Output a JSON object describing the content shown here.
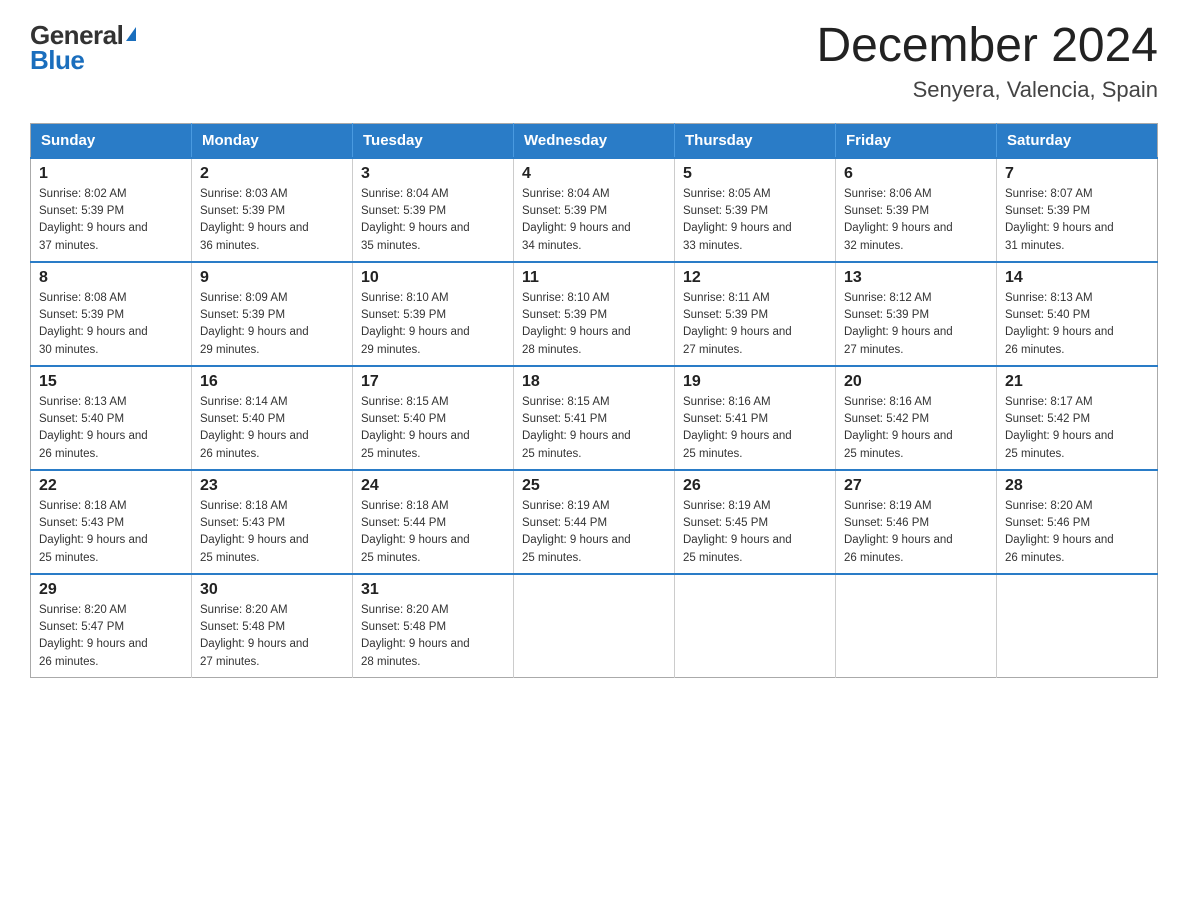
{
  "logo": {
    "general": "General",
    "blue": "Blue",
    "triangle": "▲"
  },
  "header": {
    "month_title": "December 2024",
    "location": "Senyera, Valencia, Spain"
  },
  "days_of_week": [
    "Sunday",
    "Monday",
    "Tuesday",
    "Wednesday",
    "Thursday",
    "Friday",
    "Saturday"
  ],
  "weeks": [
    [
      {
        "day": "1",
        "sunrise": "Sunrise: 8:02 AM",
        "sunset": "Sunset: 5:39 PM",
        "daylight": "Daylight: 9 hours and 37 minutes."
      },
      {
        "day": "2",
        "sunrise": "Sunrise: 8:03 AM",
        "sunset": "Sunset: 5:39 PM",
        "daylight": "Daylight: 9 hours and 36 minutes."
      },
      {
        "day": "3",
        "sunrise": "Sunrise: 8:04 AM",
        "sunset": "Sunset: 5:39 PM",
        "daylight": "Daylight: 9 hours and 35 minutes."
      },
      {
        "day": "4",
        "sunrise": "Sunrise: 8:04 AM",
        "sunset": "Sunset: 5:39 PM",
        "daylight": "Daylight: 9 hours and 34 minutes."
      },
      {
        "day": "5",
        "sunrise": "Sunrise: 8:05 AM",
        "sunset": "Sunset: 5:39 PM",
        "daylight": "Daylight: 9 hours and 33 minutes."
      },
      {
        "day": "6",
        "sunrise": "Sunrise: 8:06 AM",
        "sunset": "Sunset: 5:39 PM",
        "daylight": "Daylight: 9 hours and 32 minutes."
      },
      {
        "day": "7",
        "sunrise": "Sunrise: 8:07 AM",
        "sunset": "Sunset: 5:39 PM",
        "daylight": "Daylight: 9 hours and 31 minutes."
      }
    ],
    [
      {
        "day": "8",
        "sunrise": "Sunrise: 8:08 AM",
        "sunset": "Sunset: 5:39 PM",
        "daylight": "Daylight: 9 hours and 30 minutes."
      },
      {
        "day": "9",
        "sunrise": "Sunrise: 8:09 AM",
        "sunset": "Sunset: 5:39 PM",
        "daylight": "Daylight: 9 hours and 29 minutes."
      },
      {
        "day": "10",
        "sunrise": "Sunrise: 8:10 AM",
        "sunset": "Sunset: 5:39 PM",
        "daylight": "Daylight: 9 hours and 29 minutes."
      },
      {
        "day": "11",
        "sunrise": "Sunrise: 8:10 AM",
        "sunset": "Sunset: 5:39 PM",
        "daylight": "Daylight: 9 hours and 28 minutes."
      },
      {
        "day": "12",
        "sunrise": "Sunrise: 8:11 AM",
        "sunset": "Sunset: 5:39 PM",
        "daylight": "Daylight: 9 hours and 27 minutes."
      },
      {
        "day": "13",
        "sunrise": "Sunrise: 8:12 AM",
        "sunset": "Sunset: 5:39 PM",
        "daylight": "Daylight: 9 hours and 27 minutes."
      },
      {
        "day": "14",
        "sunrise": "Sunrise: 8:13 AM",
        "sunset": "Sunset: 5:40 PM",
        "daylight": "Daylight: 9 hours and 26 minutes."
      }
    ],
    [
      {
        "day": "15",
        "sunrise": "Sunrise: 8:13 AM",
        "sunset": "Sunset: 5:40 PM",
        "daylight": "Daylight: 9 hours and 26 minutes."
      },
      {
        "day": "16",
        "sunrise": "Sunrise: 8:14 AM",
        "sunset": "Sunset: 5:40 PM",
        "daylight": "Daylight: 9 hours and 26 minutes."
      },
      {
        "day": "17",
        "sunrise": "Sunrise: 8:15 AM",
        "sunset": "Sunset: 5:40 PM",
        "daylight": "Daylight: 9 hours and 25 minutes."
      },
      {
        "day": "18",
        "sunrise": "Sunrise: 8:15 AM",
        "sunset": "Sunset: 5:41 PM",
        "daylight": "Daylight: 9 hours and 25 minutes."
      },
      {
        "day": "19",
        "sunrise": "Sunrise: 8:16 AM",
        "sunset": "Sunset: 5:41 PM",
        "daylight": "Daylight: 9 hours and 25 minutes."
      },
      {
        "day": "20",
        "sunrise": "Sunrise: 8:16 AM",
        "sunset": "Sunset: 5:42 PM",
        "daylight": "Daylight: 9 hours and 25 minutes."
      },
      {
        "day": "21",
        "sunrise": "Sunrise: 8:17 AM",
        "sunset": "Sunset: 5:42 PM",
        "daylight": "Daylight: 9 hours and 25 minutes."
      }
    ],
    [
      {
        "day": "22",
        "sunrise": "Sunrise: 8:18 AM",
        "sunset": "Sunset: 5:43 PM",
        "daylight": "Daylight: 9 hours and 25 minutes."
      },
      {
        "day": "23",
        "sunrise": "Sunrise: 8:18 AM",
        "sunset": "Sunset: 5:43 PM",
        "daylight": "Daylight: 9 hours and 25 minutes."
      },
      {
        "day": "24",
        "sunrise": "Sunrise: 8:18 AM",
        "sunset": "Sunset: 5:44 PM",
        "daylight": "Daylight: 9 hours and 25 minutes."
      },
      {
        "day": "25",
        "sunrise": "Sunrise: 8:19 AM",
        "sunset": "Sunset: 5:44 PM",
        "daylight": "Daylight: 9 hours and 25 minutes."
      },
      {
        "day": "26",
        "sunrise": "Sunrise: 8:19 AM",
        "sunset": "Sunset: 5:45 PM",
        "daylight": "Daylight: 9 hours and 25 minutes."
      },
      {
        "day": "27",
        "sunrise": "Sunrise: 8:19 AM",
        "sunset": "Sunset: 5:46 PM",
        "daylight": "Daylight: 9 hours and 26 minutes."
      },
      {
        "day": "28",
        "sunrise": "Sunrise: 8:20 AM",
        "sunset": "Sunset: 5:46 PM",
        "daylight": "Daylight: 9 hours and 26 minutes."
      }
    ],
    [
      {
        "day": "29",
        "sunrise": "Sunrise: 8:20 AM",
        "sunset": "Sunset: 5:47 PM",
        "daylight": "Daylight: 9 hours and 26 minutes."
      },
      {
        "day": "30",
        "sunrise": "Sunrise: 8:20 AM",
        "sunset": "Sunset: 5:48 PM",
        "daylight": "Daylight: 9 hours and 27 minutes."
      },
      {
        "day": "31",
        "sunrise": "Sunrise: 8:20 AM",
        "sunset": "Sunset: 5:48 PM",
        "daylight": "Daylight: 9 hours and 28 minutes."
      },
      null,
      null,
      null,
      null
    ]
  ]
}
